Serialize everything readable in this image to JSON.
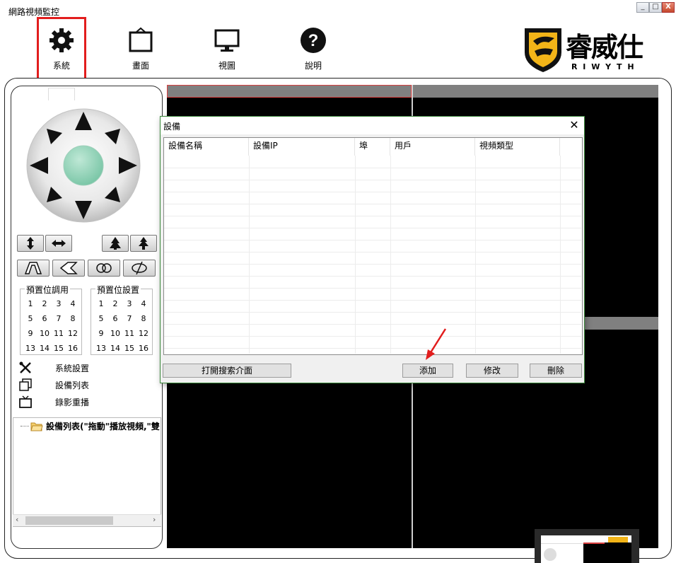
{
  "window": {
    "title": "網路視頻監控",
    "minimize": "_",
    "maximize": "□",
    "close": "X"
  },
  "toolbar": {
    "items": [
      {
        "label": "系統",
        "icon": "gear-icon"
      },
      {
        "label": "畫面",
        "icon": "frame-icon"
      },
      {
        "label": "視圖",
        "icon": "monitor-icon"
      },
      {
        "label": "說明",
        "icon": "help-icon"
      }
    ]
  },
  "logo": {
    "text": "睿威仕",
    "subtitle": "R I W Y T H"
  },
  "presets": {
    "call_label": "預置位調用",
    "set_label": "預置位設置",
    "numbers": [
      "1",
      "2",
      "3",
      "4",
      "5",
      "6",
      "7",
      "8",
      "9",
      "10",
      "11",
      "12",
      "13",
      "14",
      "15",
      "16"
    ]
  },
  "menu": {
    "items": [
      {
        "label": "系統設置",
        "icon": "tools-icon"
      },
      {
        "label": "設備列表",
        "icon": "device-list-icon"
      },
      {
        "label": "錄影重播",
        "icon": "tv-icon"
      }
    ]
  },
  "tree": {
    "root_label": "設備列表(\"拖動\"播放視頻,\"雙"
  },
  "dialog": {
    "title": "設備",
    "close": "✕",
    "columns": [
      "設備名稱",
      "設備IP",
      "埠",
      "用戶",
      "視頻類型"
    ],
    "buttons": {
      "open_search": "打開搜索介面",
      "add": "添加",
      "edit": "修改",
      "delete": "刪除"
    }
  },
  "colors": {
    "highlight": "#e21d1d",
    "video_bg": "#000000",
    "video_header": "#808080",
    "ptz_center": "#7cc7a8",
    "logo_gold": "#f2b418"
  }
}
